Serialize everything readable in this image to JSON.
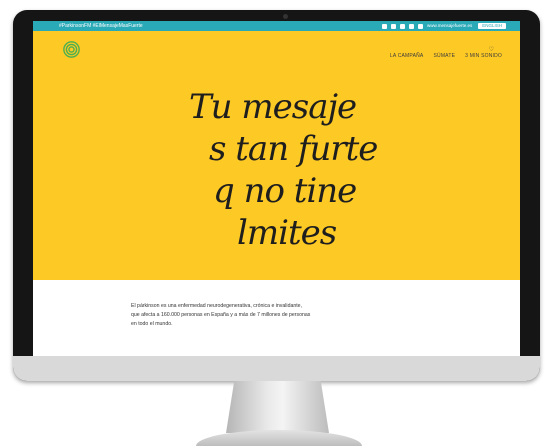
{
  "topbar": {
    "hashtags": "#ParkinsonFM #ElMensajeMasFuerte",
    "email": "www.mensajefuerte.es",
    "lang_button": "ENGLISH"
  },
  "nav": {
    "items": [
      "LA CAMPAÑA",
      "SÚMATE",
      "3 MIN SONIDO"
    ]
  },
  "hero": {
    "slogan": [
      "Tu mesaje",
      "s tan furte",
      "q no tine",
      "lmites"
    ]
  },
  "intro": {
    "text": "El párkinson es una enfermedad neurodegenerativa, crónica e invalidante, que afecta a 160.000 personas en España y a más de 7 millones de personas en todo el mundo."
  },
  "colors": {
    "hero_bg": "#fdc925",
    "topbar_bg": "#2aa9b7",
    "logo": "#4caf50"
  }
}
